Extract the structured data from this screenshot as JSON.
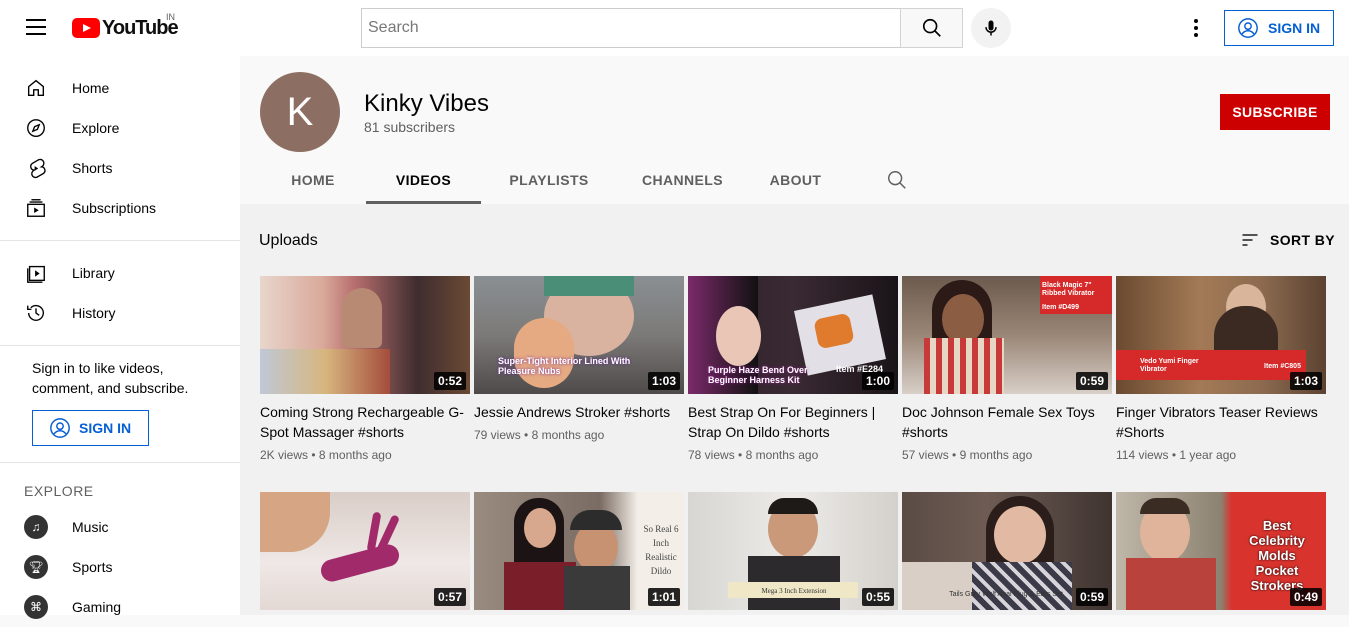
{
  "topbar": {
    "logo_text": "YouTube",
    "country_code": "IN",
    "search_placeholder": "Search",
    "signin_label": "SIGN IN"
  },
  "sidebar": {
    "items": [
      {
        "label": "Home",
        "icon": "home-icon"
      },
      {
        "label": "Explore",
        "icon": "compass-icon"
      },
      {
        "label": "Shorts",
        "icon": "shorts-icon"
      },
      {
        "label": "Subscriptions",
        "icon": "subscriptions-icon"
      }
    ],
    "library_items": [
      {
        "label": "Library",
        "icon": "library-icon"
      },
      {
        "label": "History",
        "icon": "history-icon"
      }
    ],
    "signin_message": "Sign in to like videos, comment, and subscribe.",
    "signin_label": "SIGN IN",
    "explore_heading": "EXPLORE",
    "explore_items": [
      {
        "label": "Music",
        "icon": "music-icon"
      },
      {
        "label": "Sports",
        "icon": "trophy-icon"
      },
      {
        "label": "Gaming",
        "icon": "gamepad-icon"
      }
    ]
  },
  "channel": {
    "avatar_letter": "K",
    "avatar_color": "#8d6e63",
    "name": "Kinky Vibes",
    "subscribers": "81 subscribers",
    "subscribe_label": "SUBSCRIBE",
    "tabs": [
      "HOME",
      "VIDEOS",
      "PLAYLISTS",
      "CHANNELS",
      "ABOUT"
    ],
    "active_tab": "VIDEOS"
  },
  "content": {
    "section_title": "Uploads",
    "sort_label": "SORT BY",
    "videos": [
      {
        "title": "Coming Strong Rechargeable G-Spot Massager #shorts",
        "views": "2K views",
        "age": "8 months ago",
        "duration": "0:52"
      },
      {
        "title": "Jessie Andrews Stroker #shorts",
        "views": "79 views",
        "age": "8 months ago",
        "duration": "1:03",
        "caption": "Super-Tight Interior Lined With Pleasure Nubs"
      },
      {
        "title": "Best Strap On For Beginners | Strap On Dildo #shorts",
        "views": "78 views",
        "age": "8 months ago",
        "duration": "1:00",
        "caption": "Purple Haze Bend Over Beginner Harness Kit",
        "caption2": "Item #E284"
      },
      {
        "title": "Doc Johnson Female Sex Toys #shorts",
        "views": "57 views",
        "age": "9 months ago",
        "duration": "0:59",
        "caption": "Black Magic 7\" Ribbed Vibrator",
        "caption2": "Item #D499"
      },
      {
        "title": "Finger Vibrators Teaser Reviews #Shorts",
        "views": "114 views",
        "age": "1 year ago",
        "duration": "1:03",
        "caption": "Vedo Yumi Finger Vibrator",
        "caption2": "Item #C805"
      },
      {
        "title": "",
        "views": "",
        "age": "",
        "duration": "0:57"
      },
      {
        "title": "",
        "views": "",
        "age": "",
        "duration": "1:01",
        "caption": "So Real 6 Inch Realistic Dildo"
      },
      {
        "title": "",
        "views": "",
        "age": "",
        "duration": "0:55",
        "caption": "Mega 3 Inch Extension"
      },
      {
        "title": "",
        "views": "",
        "age": "",
        "duration": "0:59",
        "caption": "Tails Grey Wolf Anal Plug & Ears Set"
      },
      {
        "title": "",
        "views": "",
        "age": "",
        "duration": "0:49",
        "caption": "Best Celebrity Molds Pocket Strokers"
      }
    ]
  },
  "colors": {
    "subscribe_red": "#cc0000",
    "link_blue": "#065fd4",
    "youtube_red": "#ff0000"
  }
}
